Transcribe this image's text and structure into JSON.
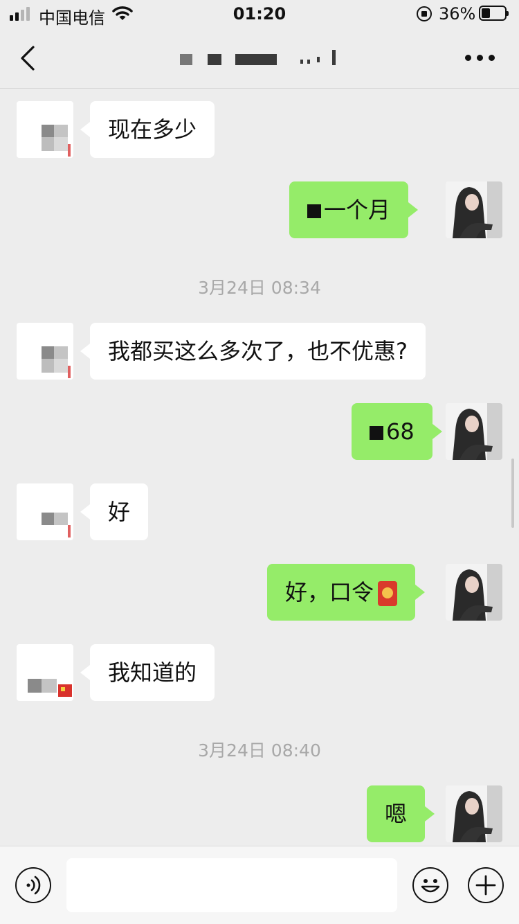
{
  "status_bar": {
    "carrier": "中国电信",
    "time": "01:20",
    "battery_percent": "36%",
    "battery_level": 0.36,
    "signal_bars": 2
  },
  "nav": {
    "back_icon": "chevron-left-icon",
    "title_redacted": true,
    "more_icon": "more-dots-icon"
  },
  "timestamps": [
    "3月24日 08:34",
    "3月24日 08:40"
  ],
  "messages": [
    {
      "side": "in",
      "text": "现在多少"
    },
    {
      "side": "out",
      "text": "一个月",
      "partially_redacted": true
    },
    {
      "side": "in",
      "text": "我都买这么多次了，也不优惠?"
    },
    {
      "side": "out",
      "text": "68",
      "partially_redacted": true
    },
    {
      "side": "in",
      "text": "好"
    },
    {
      "side": "out",
      "text": "好，口令",
      "attachment_icon": "red-packet-icon"
    },
    {
      "side": "in",
      "text": "我知道的"
    },
    {
      "side": "out",
      "text": "嗯"
    }
  ],
  "input_bar": {
    "voice_icon": "voice-icon",
    "text_value": "",
    "emoji_icon": "emoji-icon",
    "add_icon": "plus-icon"
  },
  "colors": {
    "outgoing_bubble": "#95ec69",
    "incoming_bubble": "#ffffff",
    "background": "#ededed"
  }
}
